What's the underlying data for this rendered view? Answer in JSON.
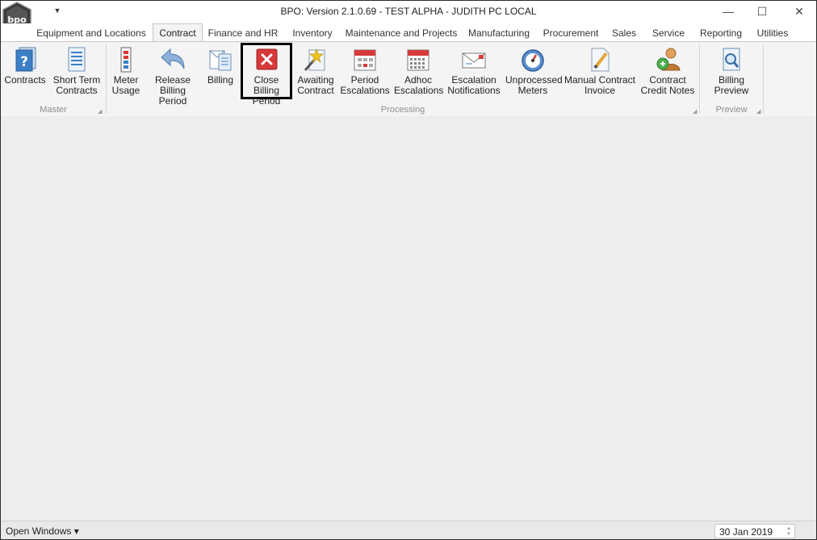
{
  "window": {
    "title": "BPO: Version 2.1.0.69 - TEST ALPHA - JUDITH PC LOCAL",
    "logo_text": "bpo",
    "controls": {
      "minimize": "—",
      "maximize": "☐",
      "close": "✕"
    },
    "quick_access_glyph": "▼"
  },
  "tabs": [
    {
      "label": "Equipment and Locations"
    },
    {
      "label": "Contract"
    },
    {
      "label": "Finance and HR"
    },
    {
      "label": "Inventory"
    },
    {
      "label": "Maintenance and Projects"
    },
    {
      "label": "Manufacturing"
    },
    {
      "label": "Procurement"
    },
    {
      "label": "Sales"
    },
    {
      "label": "Service"
    },
    {
      "label": "Reporting"
    },
    {
      "label": "Utilities"
    }
  ],
  "ribbon": {
    "groups": [
      {
        "label": "Master",
        "buttons": [
          {
            "label": "Contracts",
            "icon": "contracts-icon"
          },
          {
            "label": "Short Term\nContracts",
            "icon": "document-list-icon"
          }
        ]
      },
      {
        "label": "Processing",
        "buttons": [
          {
            "label": "Meter\nUsage",
            "icon": "meter-icon"
          },
          {
            "label": "Release\nBilling Period",
            "icon": "undo-arrow-icon"
          },
          {
            "label": "Billing",
            "icon": "billing-icon"
          },
          {
            "label": "Close Billing\nPeriod",
            "icon": "close-x-icon"
          },
          {
            "label": "Awaiting\nContract",
            "icon": "magic-wand-icon"
          },
          {
            "label": "Period\nEscalations",
            "icon": "calendar-icon"
          },
          {
            "label": "Adhoc\nEscalations",
            "icon": "calendar-grid-icon"
          },
          {
            "label": "Escalation\nNotifications",
            "icon": "envelope-icon"
          },
          {
            "label": "Unprocessed\nMeters",
            "icon": "gauge-icon"
          },
          {
            "label": "Manual Contract\nInvoice",
            "icon": "pencil-document-icon"
          },
          {
            "label": "Contract\nCredit Notes",
            "icon": "credit-note-icon"
          }
        ]
      },
      {
        "label": "Preview",
        "buttons": [
          {
            "label": "Billing\nPreview",
            "icon": "magnifier-document-icon"
          }
        ]
      }
    ],
    "launcher_glyph": "◢"
  },
  "status": {
    "open_windows": "Open Windows",
    "dropdown_glyph": "▾",
    "date": "30 Jan 2019",
    "spin_up": "▲",
    "spin_down": "▼"
  }
}
